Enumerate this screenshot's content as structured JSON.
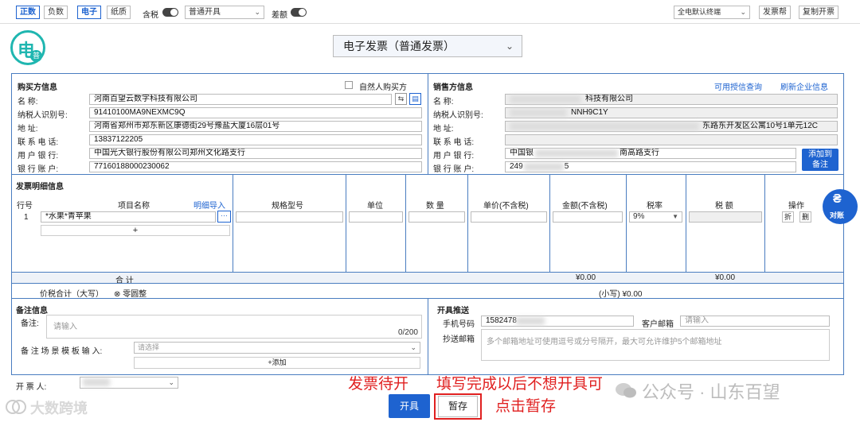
{
  "toolbar": {
    "zhengshu": "正数",
    "fushu": "负数",
    "dianzi": "电子",
    "zhizhi": "纸质",
    "hanshui": "含税",
    "kaiju_type": "普通开具",
    "chae": "差额",
    "zhongduan": "全电默认终端",
    "help": "发票帮",
    "copy": "复制开票"
  },
  "logo": {
    "char": "电",
    "sub": "普"
  },
  "invoice_type": "电子发票（普通发票）",
  "buyer": {
    "title": "购买方信息",
    "natural_person": "自然人购买方",
    "labels": {
      "name": "名          称:",
      "tax_id": "纳税人识别号:",
      "address": "地          址:",
      "phone": "联   系   电   话:",
      "bank": "用   户   银   行:",
      "account": "银   行   账   户:"
    },
    "name": "河南百望云数字科技有限公司",
    "tax_id": "91410100MA9NEXMC9Q",
    "address": "河南省郑州市郑东新区康德街29号豫盐大厦16层01号",
    "phone": "13837122205",
    "bank": "中国光大银行股份有限公司郑州文化路支行",
    "account": "77160188000230062"
  },
  "seller": {
    "title": "销售方信息",
    "link_query": "可用授信查询",
    "link_refresh": "刷新企业信息",
    "labels": {
      "name": "名          称:",
      "tax_id": "纳税人识别号:",
      "address": "地          址:",
      "phone": "联   系   电   话:",
      "bank": "用   户   银   行:",
      "account": "银   行   账   户:"
    },
    "name_suffix": "科技有限公司",
    "tax_id_suffix": "NNH9C1Y",
    "address_suffix": "东路东开发区公寓10号1单元12C",
    "bank_prefix": "中国银",
    "bank_suffix": "南高路支行",
    "account_prefix": "249",
    "account_suffix": "5",
    "add_btn": "添加到备注"
  },
  "detail": {
    "title": "发票明细信息",
    "headers": {
      "row": "行号",
      "item": "项目名称",
      "import": "明细导入",
      "spec": "规格型号",
      "unit": "单位",
      "qty": "数 量",
      "price": "单价(不含税)",
      "amount": "金额(不含税)",
      "rate": "税率",
      "tax": "税 额",
      "ops": "操作"
    },
    "rows": [
      {
        "no": "1",
        "name": "*水果*青苹果",
        "rate": "9%",
        "op1": "折",
        "op2": "删"
      }
    ],
    "add": "+",
    "total_label": "合          计",
    "total_amount": "¥0.00",
    "total_tax": "¥0.00",
    "daxie_label": "价税合计（大写）",
    "daxie_value": "⊗ 零圆整",
    "xiaoxie": "(小写) ¥0.00"
  },
  "remarks": {
    "title": "备注信息",
    "label": "备注:",
    "placeholder": "请输入",
    "counter": "0/200",
    "template_label": "备  注  场  景  模  板  输  入:",
    "template_placeholder": "请选择",
    "add": "+添加"
  },
  "push": {
    "title": "开具推送",
    "phone_label": "手机号码",
    "phone_value": "1582478",
    "email_label": "客户邮箱",
    "email_placeholder": "请输入",
    "cc_label": "抄送邮箱",
    "cc_placeholder": "多个邮箱地址可使用逗号或分号隔开，最大可允许维护5个邮箱地址"
  },
  "issuer": {
    "label": "开      票      人:"
  },
  "side_badge": {
    "text": "对账"
  },
  "buttons": {
    "issue": "开具",
    "save": "暂存"
  },
  "annotations": {
    "a1": "发票待开",
    "a2": "填写完成以后不想开具可",
    "a3": "点击暂存",
    "watermark_left": "大数跨境",
    "watermark_right": "公众号 · 山东百望"
  },
  "colors": {
    "accent": "#1e63d0",
    "annotation": "#e02020",
    "border": "#4a7dc0"
  }
}
